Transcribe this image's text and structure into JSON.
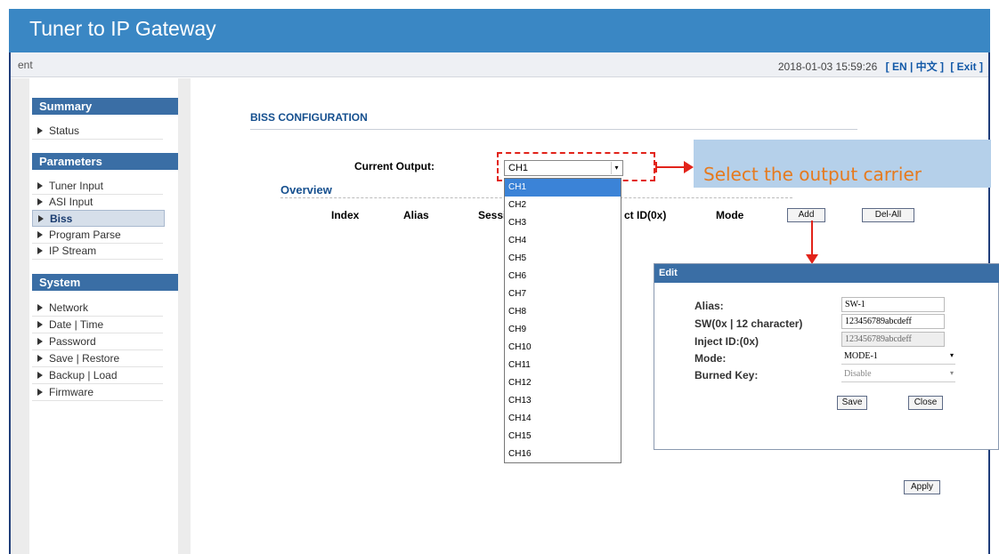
{
  "app": {
    "title": "Tuner to IP Gateway"
  },
  "topbar": {
    "crumb": "ent",
    "datetime": "2018-01-03 15:59:26",
    "lang": "[ EN | 中文 ]",
    "exit": "[ Exit ]"
  },
  "sidebar": {
    "sections": [
      {
        "title": "Summary",
        "items": [
          "Status"
        ]
      },
      {
        "title": "Parameters",
        "items": [
          "Tuner Input",
          "ASI Input",
          "Biss",
          "Program Parse",
          "IP Stream"
        ]
      },
      {
        "title": "System",
        "items": [
          "Network",
          "Date | Time",
          "Password",
          "Save | Restore",
          "Backup | Load",
          "Firmware"
        ]
      }
    ],
    "active": "Biss"
  },
  "main": {
    "title": "BISS CONFIGURATION",
    "current_output_label": "Current Output:",
    "current_output_value": "CH1",
    "overview": "Overview",
    "columns": [
      "Index",
      "Alias",
      "Sessi",
      "ct ID(0x)",
      "Mode"
    ],
    "add_label": "Add",
    "delall_label": "Del-All",
    "apply_label": "Apply",
    "dropdown_options": [
      "CH1",
      "CH2",
      "CH3",
      "CH4",
      "CH5",
      "CH6",
      "CH7",
      "CH8",
      "CH9",
      "CH10",
      "CH11",
      "CH12",
      "CH13",
      "CH14",
      "CH15",
      "CH16"
    ],
    "dropdown_selected": "CH1"
  },
  "callout": {
    "text": "Select the output carrier",
    "color": "#e67a1e",
    "bg": "#b5d0ea"
  },
  "edit": {
    "title": "Edit",
    "fields": [
      {
        "label": "Alias:",
        "value": "SW-1"
      },
      {
        "label": "SW(0x | 12 character)",
        "value": "123456789abcdeff"
      },
      {
        "label": "Inject ID:(0x)",
        "value": "123456789abcdeff"
      },
      {
        "label": "Mode:",
        "value": "MODE-1"
      },
      {
        "label": "Burned Key:",
        "value": "Disable"
      }
    ],
    "save_label": "Save",
    "close_label": "Close"
  },
  "colors": {
    "header": "#3a87c4",
    "section": "#3a6ea5",
    "accent_red": "#e2231a"
  }
}
